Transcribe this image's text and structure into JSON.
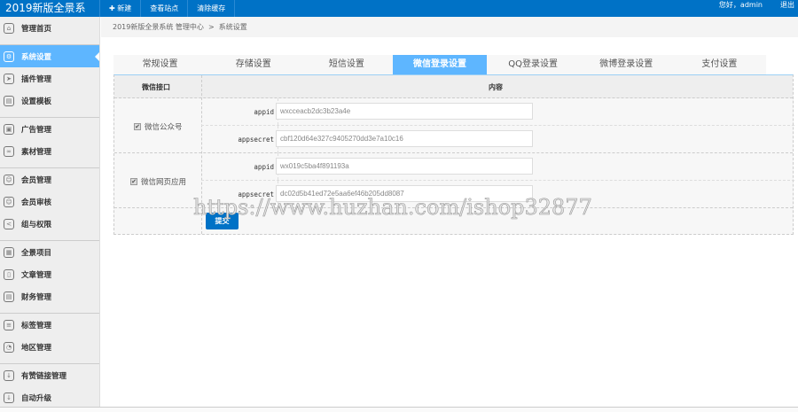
{
  "app": {
    "title": "2019新版全景系",
    "user": "您好，admin",
    "logout": "退出"
  },
  "topnav": [
    "新建",
    "查看站点",
    "清除缓存"
  ],
  "sidebar": [
    {
      "label": "管理首页",
      "icon": "home-icon"
    },
    {
      "label": "系统设置",
      "icon": "gear-icon"
    },
    {
      "label": "插件管理",
      "icon": "send-icon"
    },
    {
      "label": "设置模板",
      "icon": "template-icon"
    },
    {
      "label": "广告管理",
      "icon": "image-icon"
    },
    {
      "label": "素材管理",
      "icon": "link-icon"
    },
    {
      "label": "会员管理",
      "icon": "users-icon"
    },
    {
      "label": "会员审核",
      "icon": "users-icon"
    },
    {
      "label": "组与权限",
      "icon": "share-icon"
    },
    {
      "label": "全景项目",
      "icon": "grid-icon"
    },
    {
      "label": "文章管理",
      "icon": "file-icon"
    },
    {
      "label": "财务管理",
      "icon": "wallet-icon"
    },
    {
      "label": "标签管理",
      "icon": "tag-icon"
    },
    {
      "label": "地区管理",
      "icon": "pie-icon"
    },
    {
      "label": "有赞链接管理",
      "icon": "download-icon"
    },
    {
      "label": "自动升级",
      "icon": "download-icon"
    }
  ],
  "breadcrumb": {
    "root": "2019新版全景系统 管理中心",
    "sep": ">",
    "current": "系统设置"
  },
  "tabs": [
    "常规设置",
    "存储设置",
    "短信设置",
    "微信登录设置",
    "QQ登录设置",
    "微博登录设置",
    "支付设置"
  ],
  "table": {
    "col1": "微信接口",
    "col2": "内容",
    "groups": [
      {
        "label": "微信公众号",
        "checked": true,
        "fields": [
          {
            "label": "appid",
            "value": "wxcceacb2dc3b23a4e"
          },
          {
            "label": "appsecret",
            "value": "cbf120d64e327c9405270dd3e7a10c16"
          }
        ]
      },
      {
        "label": "微信网页应用",
        "checked": true,
        "fields": [
          {
            "label": "appid",
            "value": "wx019c5ba4f891193a"
          },
          {
            "label": "appsecret",
            "value": "dc02d5b41ed72e5aa6ef46b205dd8087"
          }
        ]
      }
    ]
  },
  "submit": "提交",
  "watermark": "https://www.huzhan.com/ishop32877"
}
